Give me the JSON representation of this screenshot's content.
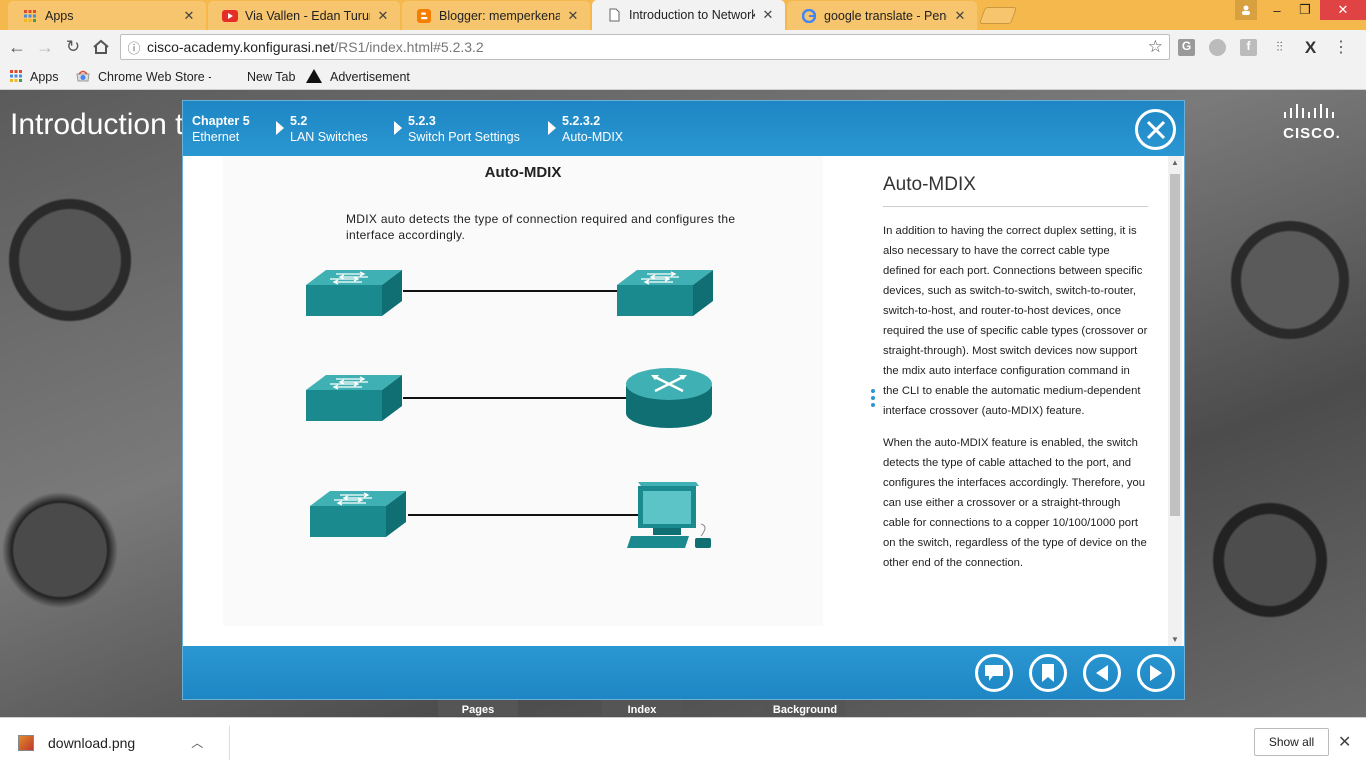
{
  "browser": {
    "tabs": [
      {
        "title": "Apps",
        "icon": "apps-grid-icon"
      },
      {
        "title": "Via Vallen - Edan Turun (",
        "icon": "youtube-icon"
      },
      {
        "title": "Blogger: memperkenalka",
        "icon": "blogger-icon"
      },
      {
        "title": "Introduction to Networks",
        "icon": "document-icon",
        "active": true
      },
      {
        "title": "google translate - Penelu",
        "icon": "google-icon"
      }
    ],
    "url_host": "cisco-academy.konfigurasi.net",
    "url_path": "/RS1/index.html#5.2.3.2",
    "bookmarks": [
      {
        "label": "Apps",
        "icon": "apps-grid-icon"
      },
      {
        "label": "Chrome Web Store -",
        "icon": "chrome-store-icon"
      },
      {
        "label": "New Tab",
        "icon": "none"
      },
      {
        "label": "Advertisement",
        "icon": "triangle-icon"
      }
    ]
  },
  "page": {
    "bg_title": "Introduction t",
    "logo_text": "CISCO.",
    "low_tabs": [
      "Pages",
      "Index",
      "Background"
    ]
  },
  "modal": {
    "breadcrumbs": [
      {
        "num": "Chapter 5",
        "label": "Ethernet"
      },
      {
        "num": "5.2",
        "label": "LAN Switches"
      },
      {
        "num": "5.2.3",
        "label": "Switch Port Settings"
      },
      {
        "num": "5.2.3.2",
        "label": "Auto-MDIX"
      }
    ],
    "figure": {
      "title": "Auto-MDIX",
      "description": "MDIX auto detects the type of connection required and configures the interface accordingly."
    },
    "content": {
      "title": "Auto-MDIX",
      "paragraph1": "In addition to having the correct duplex setting, it is also necessary to have the correct cable type defined for each port. Connections between specific devices, such as switch-to-switch, switch-to-router, switch-to-host, and router-to-host devices, once required the use of specific cable types (crossover or straight-through). Most switch devices now support the mdix auto interface configuration command in the CLI to enable the automatic medium-dependent interface crossover (auto-MDIX) feature.",
      "paragraph2": "When the auto-MDIX feature is enabled, the switch detects the type of cable attached to the port, and configures the interfaces accordingly. Therefore, you can use either a crossover or a straight-through cable for connections to a copper 10/100/1000 port on the switch, regardless of the type of device on the other end of the connection."
    },
    "colors": {
      "accent": "#2a97d2",
      "device": "#1a8a8e"
    }
  },
  "downloads": {
    "file": "download.png",
    "show_all": "Show all"
  }
}
